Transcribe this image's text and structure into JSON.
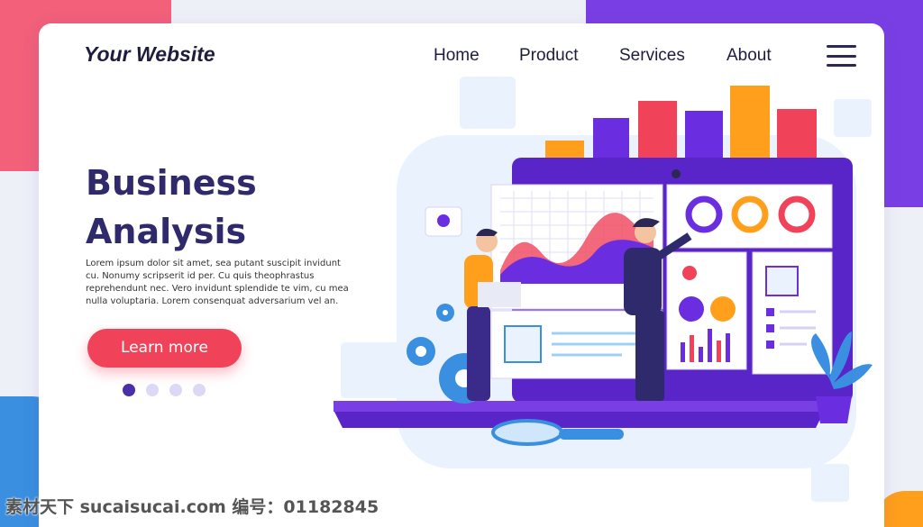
{
  "header": {
    "logo": "Your Website",
    "nav": [
      "Home",
      "Product",
      "Services",
      "About"
    ],
    "menu_icon": "hamburger-icon"
  },
  "hero": {
    "title_line1": "Business",
    "title_line2": "Analysis",
    "paragraph": "Lorem ipsum dolor sit amet, sea putant suscipit invidunt cu. Nonumy scripserit id per. Cu quis theophrastus reprehendunt nec. Vero invidunt splendide te vim, cu mea nulla voluptaria. Lorem consenquat adversarium vel an.",
    "cta": "Learn more",
    "carousel": {
      "count": 4,
      "active": 1
    }
  },
  "watermark": "素材天下 sucaisucai.com  编号：01182845",
  "colors": {
    "primary": "#2e2a6b",
    "accent": "#f0435a",
    "purple": "#6a2ee0",
    "orange": "#ff9f1c",
    "red": "#f0435a",
    "blue": "#3a8fe0"
  }
}
